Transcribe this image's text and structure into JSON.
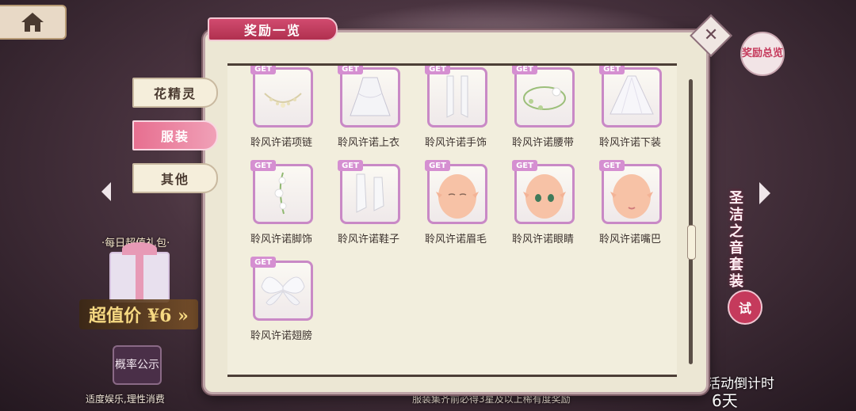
{
  "home": {
    "icon": "home-icon"
  },
  "left_panel": {
    "daily_gift_label": "·每日超值礼包·",
    "price_text": "超值价 ¥6 »",
    "probability_button": "概率公示",
    "moderation_notice": "适度娱乐,理性消费"
  },
  "right_panel": {
    "reward_overview_button": "奖励总览",
    "suit_name": "圣洁之音套装",
    "try_button": "试",
    "countdown_label": "活动倒计时",
    "countdown_value": "6天",
    "footnote": "服装集齐前必得3星及以上稀有度奖励"
  },
  "modal": {
    "title": "奖励一览",
    "close_icon": "close-x-icon",
    "categories": [
      {
        "label": "花精灵",
        "active": false
      },
      {
        "label": "服装",
        "active": true
      },
      {
        "label": "其他",
        "active": false
      }
    ],
    "badge_text": "GET",
    "items": [
      {
        "label": "聆风许诺项链",
        "icon": "necklace-icon"
      },
      {
        "label": "聆风许诺上衣",
        "icon": "dress-top-icon"
      },
      {
        "label": "聆风许诺手饰",
        "icon": "gloves-icon"
      },
      {
        "label": "聆风许诺腰带",
        "icon": "flower-belt-icon"
      },
      {
        "label": "聆风许诺下装",
        "icon": "skirt-icon"
      },
      {
        "label": "聆风许诺脚饰",
        "icon": "flower-anklet-icon"
      },
      {
        "label": "聆风许诺鞋子",
        "icon": "shoes-icon"
      },
      {
        "label": "聆风许诺眉毛",
        "icon": "eyebrows-face-icon"
      },
      {
        "label": "聆风许诺眼睛",
        "icon": "eyes-face-icon"
      },
      {
        "label": "聆风许诺嘴巴",
        "icon": "mouth-face-icon"
      },
      {
        "label": "聆风许诺翅膀",
        "icon": "wings-icon"
      }
    ]
  },
  "colors": {
    "accent_pink": "#d14b6f",
    "item_border": "#c989c6",
    "get_badge": "#d58fd1",
    "panel_bg": "#f2eedd"
  }
}
